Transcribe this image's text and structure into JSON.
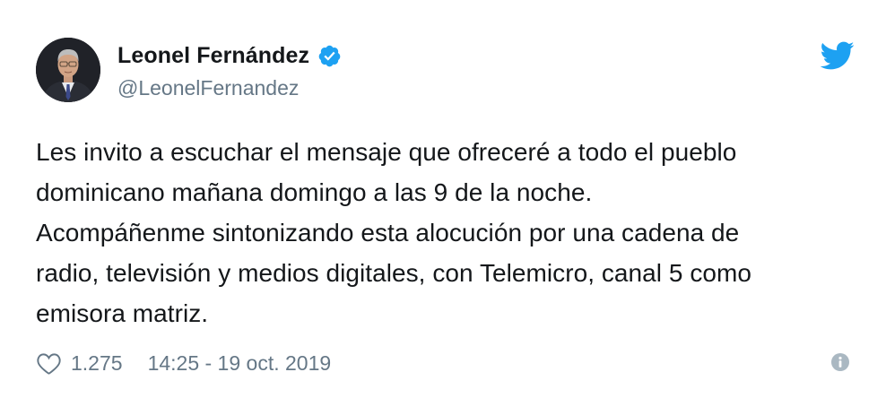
{
  "author": {
    "display_name": "Leonel Fernández",
    "handle": "@LeonelFernandez",
    "verified": true,
    "avatar_icon": "profile-photo"
  },
  "tweet": {
    "text": "Les invito a escuchar el mensaje que ofreceré a todo el pueblo\ndominicano mañana domingo a las 9 de la noche.\nAcompáñenme sintonizando esta alocución por una cadena de\nradio, televisión y medios digitales, con Telemicro, canal 5 como\nemisora matriz."
  },
  "footer": {
    "like_count": "1.275",
    "timestamp": "14:25 - 19 oct. 2019"
  },
  "icons": {
    "verified": "verified-badge-icon",
    "brand": "twitter-bird-icon",
    "like": "heart-icon",
    "info": "info-icon"
  },
  "colors": {
    "brand_blue": "#1da1f2",
    "text_primary": "#14171a",
    "text_secondary": "#657786",
    "info_gray": "#aab8c2"
  }
}
